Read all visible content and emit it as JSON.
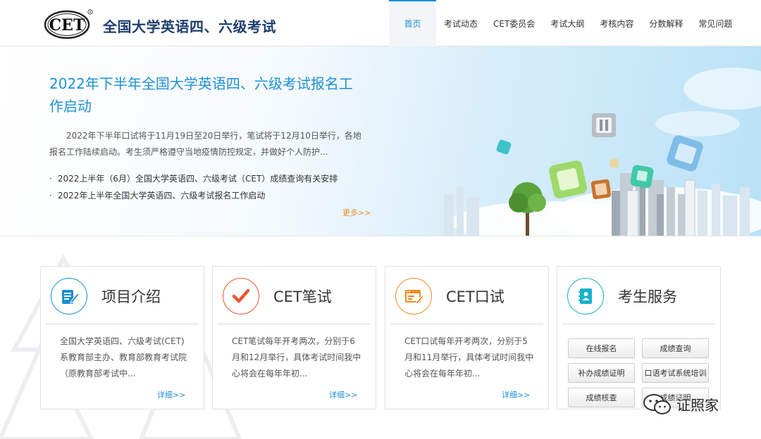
{
  "header": {
    "logo_text": "CET",
    "site_title": "全国大学英语四、六级考试",
    "nav": [
      "首页",
      "考试动态",
      "CET委员会",
      "考试大纲",
      "考核内容",
      "分数解释",
      "常见问题"
    ],
    "active_nav": "首页"
  },
  "banner": {
    "headline": "2022年下半年全国大学英语四、六级考试报名工作启动",
    "summary": "2022年下半年口试将于11月19日至20日举行，笔试将于12月10日举行，各地报名工作陆续启动。考生须严格遵守当地疫情防控规定，并做好个人防护...",
    "news": [
      "2022上半年（6月）全国大学英语四、六级考试（CET）成绩查询有关安排",
      "2022年上半年全国大学英语四、六级考试报名工作启动"
    ],
    "more": "更多>>"
  },
  "cards": [
    {
      "title": "项目介绍",
      "icon": "document-edit-icon",
      "color": "#1a8fd3",
      "body": "全国大学英语四、六级考试(CET)系教育部主办、教育部教育考试院（原教育部考试中...",
      "more": "详细>>"
    },
    {
      "title": "CET笔试",
      "icon": "checkmark-icon",
      "color": "#e8572f",
      "body": "CET笔试每年开考两次，分别于6月和12月举行，具体考试时间我中心将会在每年年初...",
      "more": "详细>>"
    },
    {
      "title": "CET口试",
      "icon": "browser-edit-icon",
      "color": "#f08a24",
      "body": "CET口试每年开考两次，分别于5月和11月举行，具体考试时间我中心将会在每年年初...",
      "more": "详细>>"
    }
  ],
  "services": {
    "title": "考生服务",
    "icon": "address-book-icon",
    "color": "#15b2c9",
    "buttons": [
      "在线报名",
      "成绩查询",
      "补办成绩证明",
      "口语考试系统培训",
      "成绩核查",
      "成绩证明"
    ]
  },
  "watermark": {
    "text": "证照家",
    "icon": "wechat-icon"
  }
}
